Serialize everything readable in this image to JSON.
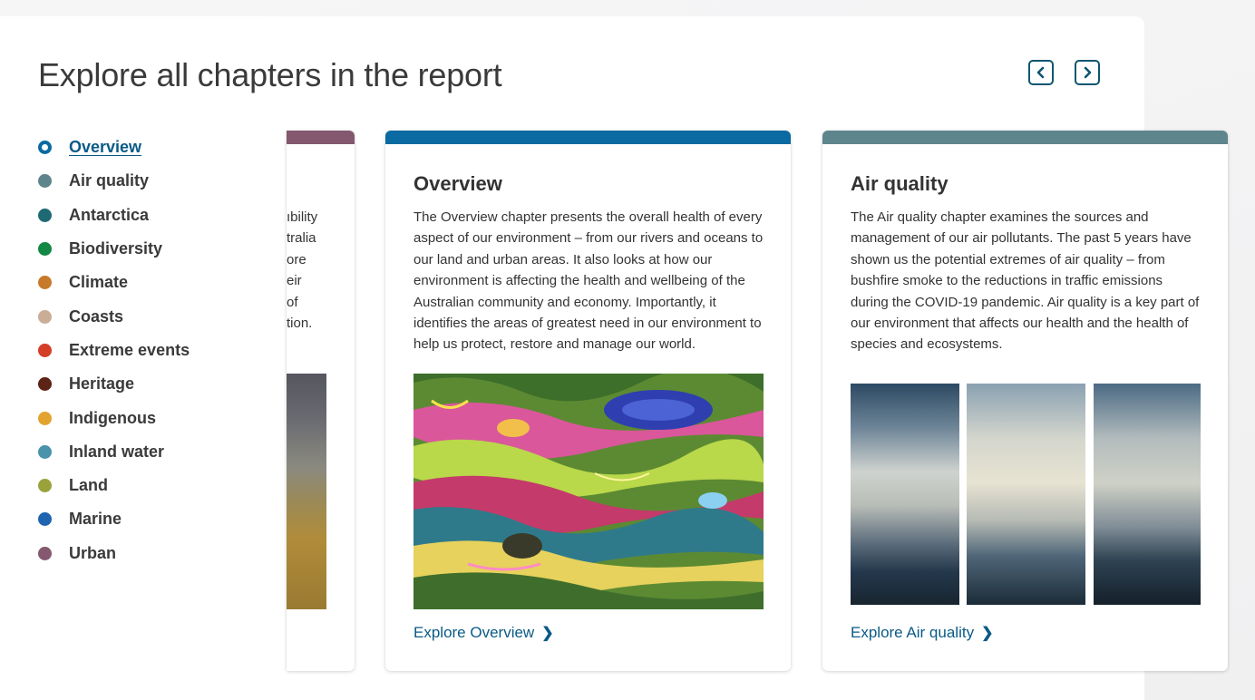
{
  "page": {
    "title": "Explore all chapters in the report"
  },
  "carousel": {
    "prev_icon": "chevron-left-icon",
    "next_icon": "chevron-right-icon"
  },
  "chapters": [
    {
      "label": "Overview",
      "color": "#0a6aa1",
      "active": true
    },
    {
      "label": "Air quality",
      "color": "#5f858c"
    },
    {
      "label": "Antarctica",
      "color": "#1f6a72"
    },
    {
      "label": "Biodiversity",
      "color": "#138844"
    },
    {
      "label": "Climate",
      "color": "#c77a2a"
    },
    {
      "label": "Coasts",
      "color": "#c9ad97"
    },
    {
      "label": "Extreme events",
      "color": "#d43d26"
    },
    {
      "label": "Heritage",
      "color": "#5c2316"
    },
    {
      "label": "Indigenous",
      "color": "#e3a330"
    },
    {
      "label": "Inland water",
      "color": "#4b93ab"
    },
    {
      "label": "Land",
      "color": "#9aa23c"
    },
    {
      "label": "Marine",
      "color": "#1f64b0"
    },
    {
      "label": "Urban",
      "color": "#84586f"
    }
  ],
  "cards": {
    "partial": {
      "bar_color": "#84586f",
      "text_fragments": "ıbility\ntralia\nore\neir\nof\ntion."
    },
    "overview": {
      "bar_color": "#0a6aa1",
      "title": "Overview",
      "description": "The Overview chapter presents the overall health of every aspect of our environment – from our rivers and oceans to our land and urban areas. It also looks at how our environment is affecting the health and wellbeing of the Australian community and economy. Importantly, it identifies the areas of greatest need in our environment to help us protect, restore and manage our world.",
      "link": "Explore Overview"
    },
    "air_quality": {
      "bar_color": "#5f858c",
      "title": "Air quality",
      "description": "The Air quality chapter examines the sources and management of our air pollutants. The past 5 years have shown us the potential extremes of air quality – from bushfire smoke to the reductions in traffic emissions during the COVID-19 pandemic. Air quality is a key part of our environment that affects our health and the health of species and ecosystems.",
      "link": "Explore Air quality"
    }
  }
}
